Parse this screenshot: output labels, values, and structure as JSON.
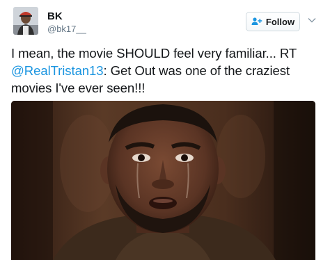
{
  "user": {
    "display_name": "BK",
    "handle": "@bk17__",
    "avatar_icon": "user-avatar"
  },
  "follow_button": {
    "label": "Follow",
    "icon": "add-user-icon"
  },
  "menu": {
    "icon": "chevron-down-icon"
  },
  "tweet": {
    "text_before": "I mean, the movie SHOULD feel very familiar... RT ",
    "mention": "@RealTristan13",
    "text_after": ": Get Out was one of the craziest movies I've ever seen!!!"
  },
  "media": {
    "type": "photo"
  },
  "colors": {
    "link": "#1b95e0",
    "text": "#14171a",
    "secondary_text": "#657786",
    "border": "#cfd9de"
  }
}
